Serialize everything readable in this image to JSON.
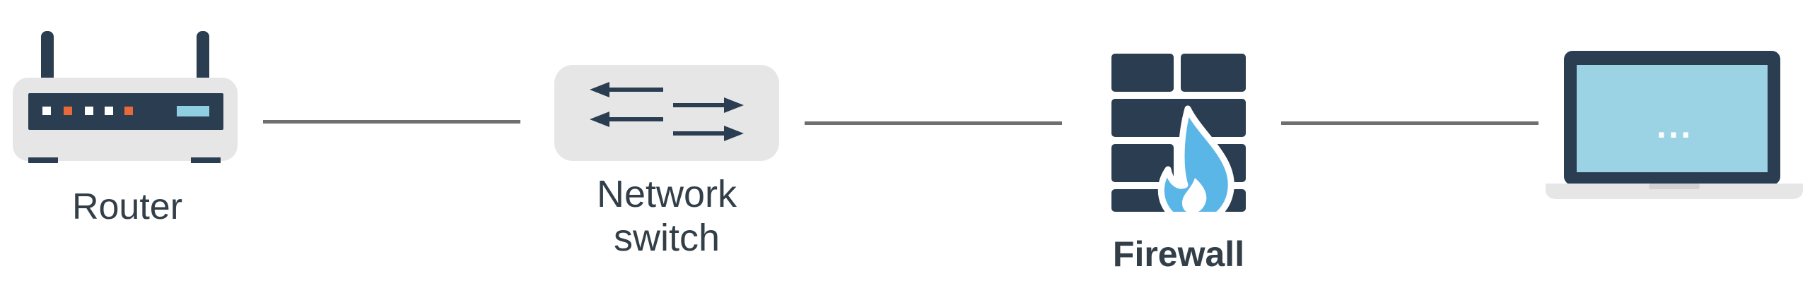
{
  "diagram": {
    "nodes": [
      {
        "id": "router",
        "label": "Router",
        "icon": "router-icon"
      },
      {
        "id": "switch",
        "label_lines": [
          "Network",
          "switch"
        ],
        "icon": "network-switch-icon"
      },
      {
        "id": "firewall",
        "label": "Firewall",
        "icon": "firewall-icon"
      },
      {
        "id": "laptop",
        "label": "",
        "icon": "laptop-icon",
        "screen_text": "..."
      }
    ],
    "connectors": 3
  },
  "colors": {
    "dark": "#2b3d50",
    "light_gray": "#e6e6e6",
    "router_light_blue": "#8fcfe1",
    "router_orange": "#e86a3a",
    "laptop_screen": "#9bd3e4",
    "flame_blue": "#5ab6e6",
    "line_gray": "#6f6f6f",
    "text": "#333f48"
  }
}
